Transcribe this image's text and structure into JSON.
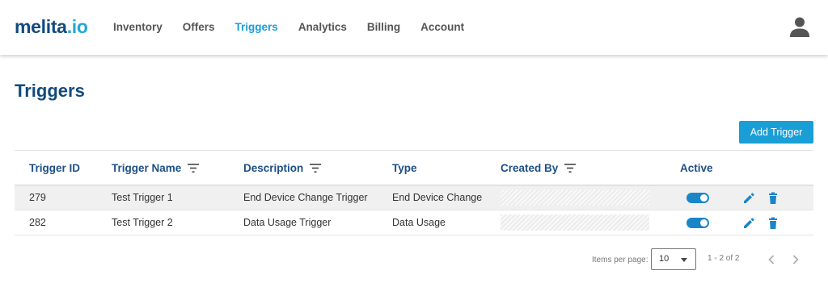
{
  "header": {
    "logo_primary": "melita",
    "logo_secondary": ".io",
    "nav": [
      {
        "label": "Inventory"
      },
      {
        "label": "Offers"
      },
      {
        "label": "Triggers",
        "active": true
      },
      {
        "label": "Analytics"
      },
      {
        "label": "Billing"
      },
      {
        "label": "Account"
      }
    ],
    "avatar_icon": "user-icon"
  },
  "page": {
    "title": "Triggers",
    "add_button": "Add Trigger"
  },
  "table": {
    "columns": [
      {
        "label": "Trigger ID",
        "filter": false
      },
      {
        "label": "Trigger Name",
        "filter": true
      },
      {
        "label": "Description",
        "filter": true
      },
      {
        "label": "Type",
        "filter": false
      },
      {
        "label": "Created By",
        "filter": true
      },
      {
        "label": "Active",
        "filter": false
      }
    ],
    "rows": [
      {
        "id": "279",
        "name": "Test Trigger 1",
        "description": "End Device Change Trigger",
        "type": "End Device Change",
        "created_by": "",
        "active": true
      },
      {
        "id": "282",
        "name": "Test Trigger 2",
        "description": "Data Usage Trigger",
        "type": "Data Usage",
        "created_by": "",
        "active": true
      }
    ],
    "row_actions": [
      "pencil-icon",
      "trash-icon"
    ]
  },
  "pagination": {
    "items_per_page_label": "Items per page:",
    "items_per_page": "10",
    "range": "1 - 2 of 2"
  },
  "colors": {
    "brand_dark": "#124a7e",
    "brand_light": "#22a8d6",
    "accent": "#1a9ed6",
    "toggle_on": "#1a86c8"
  }
}
